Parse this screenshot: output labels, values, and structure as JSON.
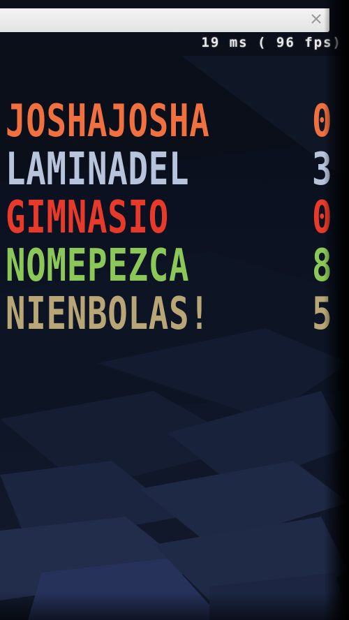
{
  "frame_info": "19 ms ( 96 fps)",
  "scoreboard": [
    {
      "name": "JOSHAJOSHA",
      "score": "0",
      "color": "#f07040"
    },
    {
      "name": "LAMINADEL",
      "score": "3",
      "color": "#b8c4dc"
    },
    {
      "name": "GIMNASIO",
      "score": "0",
      "color": "#e83a2a"
    },
    {
      "name": "NOMEPEZCA",
      "score": "8",
      "color": "#8cc858"
    },
    {
      "name": "NIENBOLAS!",
      "score": "5",
      "color": "#b8a676"
    }
  ],
  "colors": {
    "background": "#0b1120",
    "title_bar": "#f0f0f0",
    "frame_info_text": "#e8e8e8"
  },
  "icons": {
    "close": "close-icon"
  }
}
